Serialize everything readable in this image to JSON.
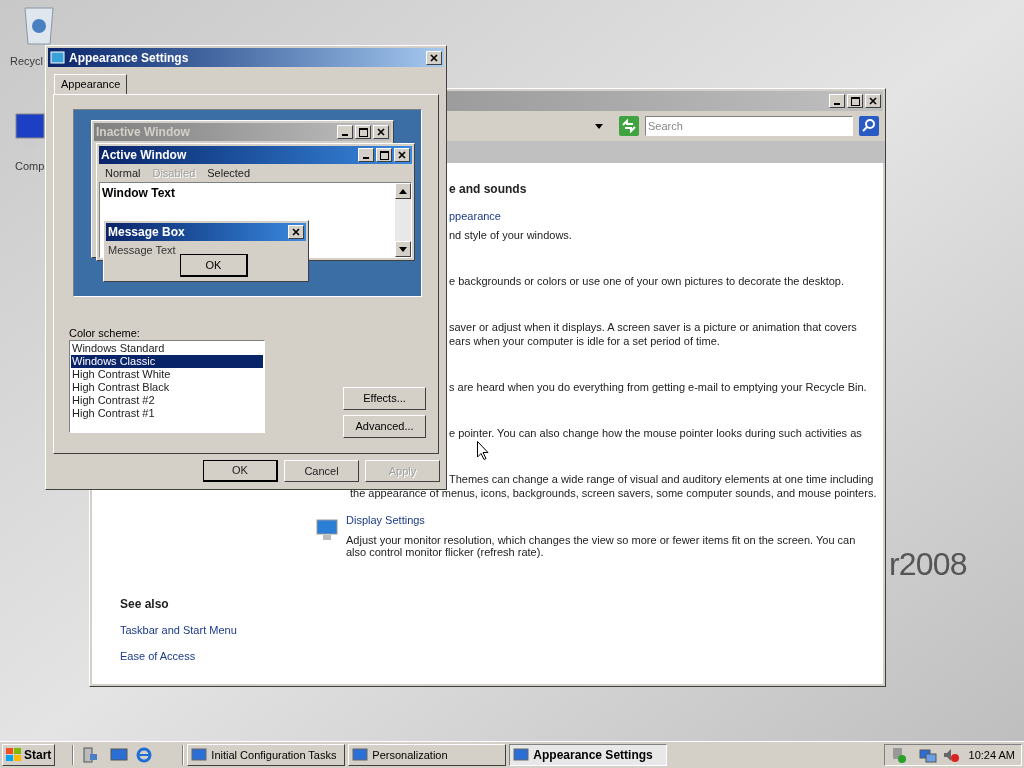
{
  "desktop": {
    "icons": [
      {
        "label": "Recycl"
      },
      {
        "label": "Comp"
      }
    ],
    "wallpaper_text": "r2008"
  },
  "back_window": {
    "search": {
      "placeholder": "Search"
    },
    "clipped_sections": [
      {
        "kind": "heading",
        "lines": [
          "e and sounds"
        ]
      },
      {
        "kind": "link",
        "lines": [
          "ppearance"
        ]
      },
      {
        "kind": "text",
        "lines": [
          "nd style of your windows."
        ]
      },
      {
        "kind": "text",
        "lines": [
          "e backgrounds or colors or use one of your own pictures to decorate the desktop."
        ]
      },
      {
        "kind": "text",
        "lines": [
          "saver or adjust when it displays. A screen saver is a picture or animation that covers",
          "ears when your computer is idle for a set period of time."
        ]
      },
      {
        "kind": "text",
        "lines": [
          "s are heard when you do everything from getting e-mail to emptying your Recycle Bin."
        ]
      },
      {
        "kind": "text",
        "lines": [
          "e pointer. You can also change how the mouse pointer looks during such activities as"
        ]
      },
      {
        "kind": "text",
        "lines": [
          "Themes can change a wide range of visual and auditory elements at one time including"
        ]
      }
    ],
    "themes_tail": "the appearance of menus, icons, backgrounds, screen savers, some computer sounds, and mouse pointers.",
    "display": {
      "link": "Display Settings",
      "description": "Adjust your monitor resolution, which changes the view so more or fewer items fit on the screen. You can also control monitor flicker (refresh rate)."
    },
    "see_also": {
      "title": "See also",
      "links": [
        "Taskbar and Start Menu",
        "Ease of Access"
      ]
    }
  },
  "dialog": {
    "title": "Appearance Settings",
    "tabs": [
      {
        "label": "Appearance",
        "selected": true
      }
    ],
    "preview": {
      "inactive_title": "Inactive Window",
      "active_title": "Active Window",
      "menu": [
        {
          "label": "Normal",
          "disabled": false
        },
        {
          "label": "Disabled",
          "disabled": true
        },
        {
          "label": "Selected",
          "disabled": false
        }
      ],
      "window_text": "Window Text",
      "message_title": "Message Box",
      "message_text": "Message Text",
      "ok": "OK"
    },
    "scheme_label": "Color scheme:",
    "schemes": [
      {
        "label": "Windows Standard",
        "selected": false
      },
      {
        "label": "Windows Classic",
        "selected": true
      },
      {
        "label": "High Contrast White",
        "selected": false
      },
      {
        "label": "High Contrast Black",
        "selected": false
      },
      {
        "label": "High Contrast #2",
        "selected": false
      },
      {
        "label": "High Contrast #1",
        "selected": false
      }
    ],
    "side_buttons": [
      "Effects...",
      "Advanced..."
    ],
    "footer_buttons": [
      {
        "label": "OK",
        "disabled": false
      },
      {
        "label": "Cancel",
        "disabled": false
      },
      {
        "label": "Apply",
        "disabled": true
      }
    ]
  },
  "taskbar": {
    "start": "Start",
    "tasks": [
      {
        "label": "Initial Configuration Tasks",
        "selected": false
      },
      {
        "label": "Personalization",
        "selected": false
      },
      {
        "label": "Appearance Settings",
        "selected": true
      }
    ],
    "clock": "10:24 AM"
  }
}
